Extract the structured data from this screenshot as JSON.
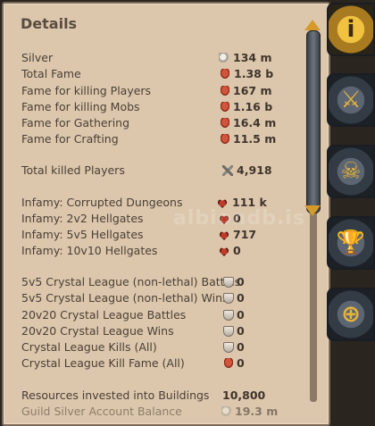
{
  "panel": {
    "title": "Details"
  },
  "rows": [
    {
      "label": "Silver",
      "icon": "silver-coins-icon",
      "value": "134 m"
    },
    {
      "label": "Total Fame",
      "icon": "fame-icon",
      "value": "1.38 b"
    },
    {
      "label": "Fame for killing Players",
      "icon": "fame-icon",
      "value": "167 m"
    },
    {
      "label": "Fame for killing Mobs",
      "icon": "fame-icon",
      "value": "1.16 b"
    },
    {
      "label": "Fame for Gathering",
      "icon": "fame-icon",
      "value": "16.4 m"
    },
    {
      "label": "Fame for Crafting",
      "icon": "fame-icon",
      "value": "11.5 m"
    },
    {
      "label": "Total killed Players",
      "icon": "crossed-swords-icon",
      "value": "4,918"
    },
    {
      "label": "Infamy: Corrupted Dungeons",
      "icon": "infamy-icon",
      "value": "111 k"
    },
    {
      "label": "Infamy: 2v2 Hellgates",
      "icon": "infamy-icon",
      "value": "0"
    },
    {
      "label": "Infamy: 5v5 Hellgates",
      "icon": "infamy-icon",
      "value": "717"
    },
    {
      "label": "Infamy: 10v10 Hellgates",
      "icon": "infamy-icon",
      "value": "0"
    },
    {
      "label": "5v5 Crystal League (non-lethal) Battles",
      "icon": "crystal-shield-icon",
      "value": "0"
    },
    {
      "label": "5v5 Crystal League (non-lethal) Wins",
      "icon": "crystal-shield-icon",
      "value": "0"
    },
    {
      "label": "20v20 Crystal League Battles",
      "icon": "crystal-shield-icon",
      "value": "0"
    },
    {
      "label": "20v20 Crystal League Wins",
      "icon": "crystal-shield-icon",
      "value": "0"
    },
    {
      "label": "Crystal League Kills (All)",
      "icon": "crystal-shield-icon",
      "value": "0"
    },
    {
      "label": "Crystal League Kill Fame (All)",
      "icon": "fame-icon",
      "value": "0"
    },
    {
      "label": "Resources invested into Buildings",
      "icon": "",
      "value": "10,800"
    },
    {
      "label": "Guild Silver Account Balance",
      "icon": "silver-coins-icon",
      "value": "19.3 m"
    }
  ],
  "watermark": "albiondb.is",
  "tabs": [
    {
      "name": "info",
      "glyph": "i"
    },
    {
      "name": "combat",
      "glyph": "⚔"
    },
    {
      "name": "kills",
      "glyph": "☠"
    },
    {
      "name": "trophies",
      "glyph": "🏆"
    },
    {
      "name": "guild-war",
      "glyph": "⊕"
    }
  ]
}
